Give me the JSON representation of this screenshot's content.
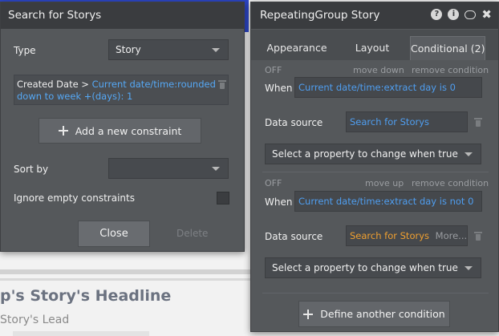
{
  "background": {
    "headline": "p's Story's Headline",
    "lead": "Story's Lead"
  },
  "search_panel": {
    "title": "Search for Storys",
    "type_label": "Type",
    "type_value": "Story",
    "constraint": {
      "key": "Created Date >",
      "value": "Current date/time:rounded down to week +(days): 1"
    },
    "add_constraint_label": "Add a new constraint",
    "sort_by_label": "Sort by",
    "sort_by_value": "",
    "ignore_empty_label": "Ignore empty constraints",
    "close_label": "Close",
    "delete_label": "Delete"
  },
  "rg_panel": {
    "title": "RepeatingGroup Story",
    "icons": [
      "help-icon",
      "info-icon",
      "comment-icon",
      "close-icon"
    ],
    "help_glyph": "?",
    "info_glyph": "i",
    "close_glyph": "✖",
    "tabs": [
      {
        "label": "Appearance"
      },
      {
        "label": "Layout"
      },
      {
        "label": "Conditional (2)"
      }
    ],
    "conditions": [
      {
        "state": "OFF",
        "move_label": "move down",
        "remove_label": "remove condition",
        "when_label": "When",
        "when_value": "Current date/time:extract day is 0",
        "data_source_label": "Data source",
        "data_source_value": "Search for Storys",
        "data_source_more": "",
        "property_placeholder": "Select a property to change when true"
      },
      {
        "state": "OFF",
        "move_label": "move up",
        "remove_label": "remove condition",
        "when_label": "When",
        "when_value": "Current date/time:extract day is not 0",
        "data_source_label": "Data source",
        "data_source_value": "Search for Storys",
        "data_source_more": "More...",
        "property_placeholder": "Select a property to change when true"
      }
    ],
    "define_condition_label": "Define another condition"
  },
  "colors": {
    "panel_bg": "#55585b",
    "header_bg": "#3a3c3f",
    "link_blue": "#4f9ef0",
    "accent_orange": "#f0a030",
    "canvas_blue": "#2d47c9"
  }
}
